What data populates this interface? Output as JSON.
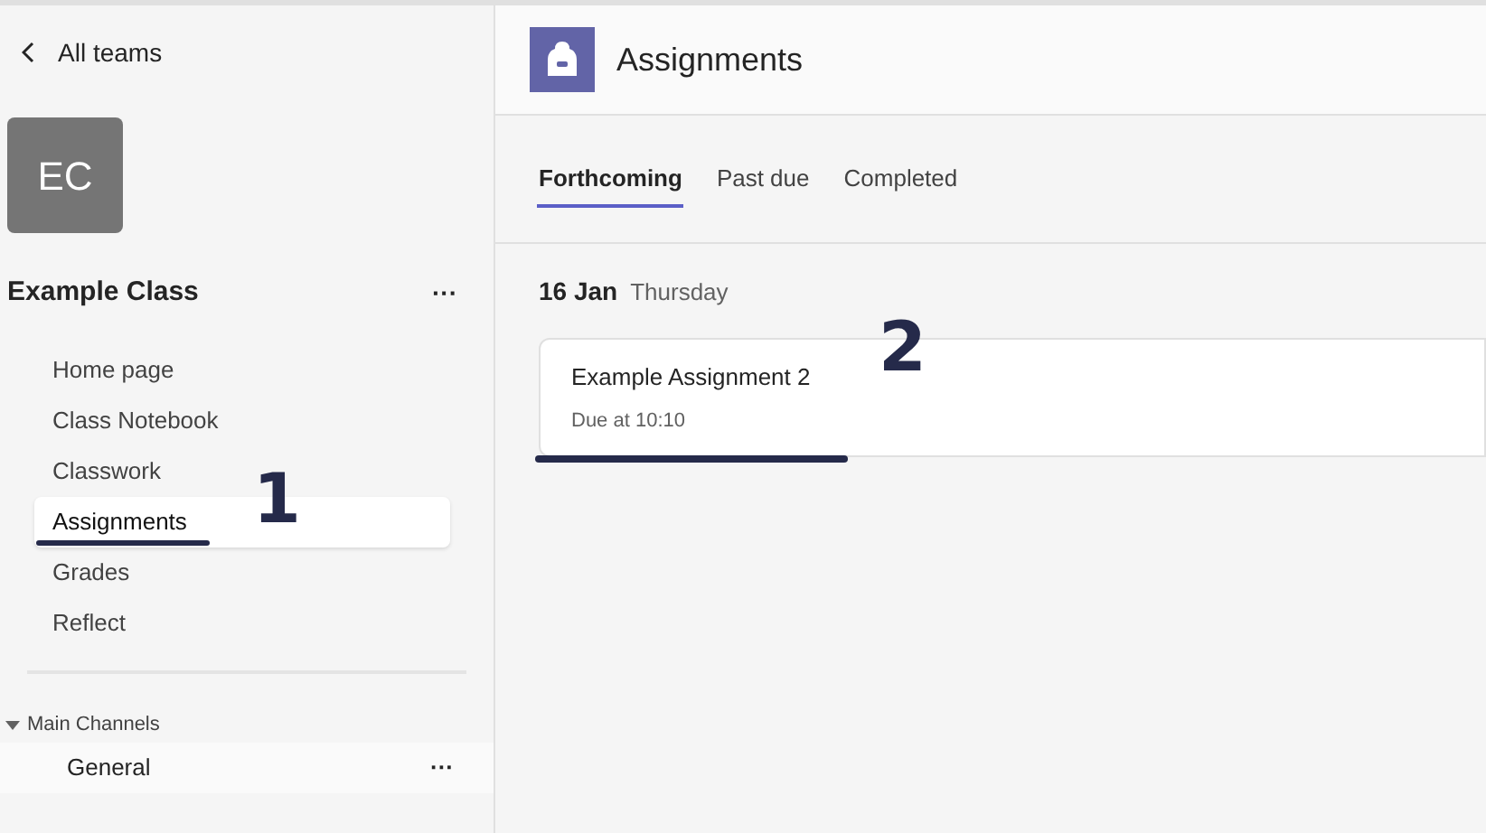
{
  "sidebar": {
    "back_link": "All teams",
    "team_avatar": "EC",
    "team_name": "Example Class",
    "more": "···",
    "items": [
      {
        "label": "Home page",
        "selected": false
      },
      {
        "label": "Class Notebook",
        "selected": false
      },
      {
        "label": "Classwork",
        "selected": false
      },
      {
        "label": "Assignments",
        "selected": true
      },
      {
        "label": "Grades",
        "selected": false
      },
      {
        "label": "Reflect",
        "selected": false
      }
    ],
    "channels_group": {
      "label": "Main Channels",
      "expanded": true,
      "channels": [
        {
          "label": "General",
          "more": "···"
        }
      ]
    }
  },
  "header": {
    "title": "Assignments"
  },
  "tabs": [
    {
      "label": "Forthcoming",
      "selected": true
    },
    {
      "label": "Past due",
      "selected": false
    },
    {
      "label": "Completed",
      "selected": false
    }
  ],
  "date_group": {
    "date": "16 Jan",
    "weekday": "Thursday",
    "assignments": [
      {
        "title": "Example Assignment 2",
        "due": "Due at 10:10"
      }
    ]
  },
  "annotations": [
    {
      "label": "1"
    },
    {
      "label": "2"
    }
  ]
}
